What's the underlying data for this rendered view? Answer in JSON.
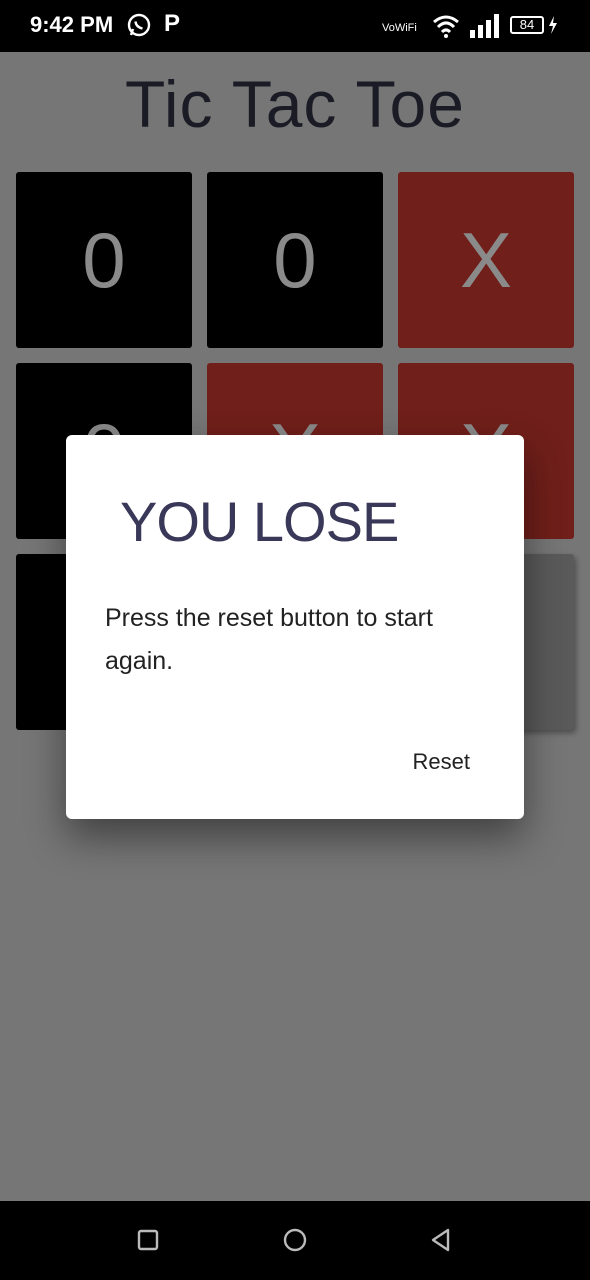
{
  "status_bar": {
    "time": "9:42 PM",
    "app_letter": "P",
    "network_label": "VoWiFi",
    "battery": "84"
  },
  "app": {
    "title": "Tic Tac Toe"
  },
  "board": {
    "cells": [
      {
        "mark": "0",
        "color": "#000000"
      },
      {
        "mark": "0",
        "color": "#000000"
      },
      {
        "mark": "X",
        "color": "#701f1a"
      },
      {
        "mark": "0",
        "color": "#000000"
      },
      {
        "mark": "X",
        "color": "#701f1a"
      },
      {
        "mark": "X",
        "color": "#701f1a"
      },
      {
        "mark": "",
        "color": "#000000"
      },
      {
        "mark": "",
        "color": "#767676"
      },
      {
        "mark": "",
        "color": "#5a5a5a"
      }
    ]
  },
  "dialog": {
    "title": "YOU LOSE",
    "message": "Press the reset button to start again.",
    "reset_label": "Reset"
  },
  "colors": {
    "overlay_background": "#767676",
    "title_color": "#1b1b26",
    "dialog_title_color": "#3a3858"
  }
}
